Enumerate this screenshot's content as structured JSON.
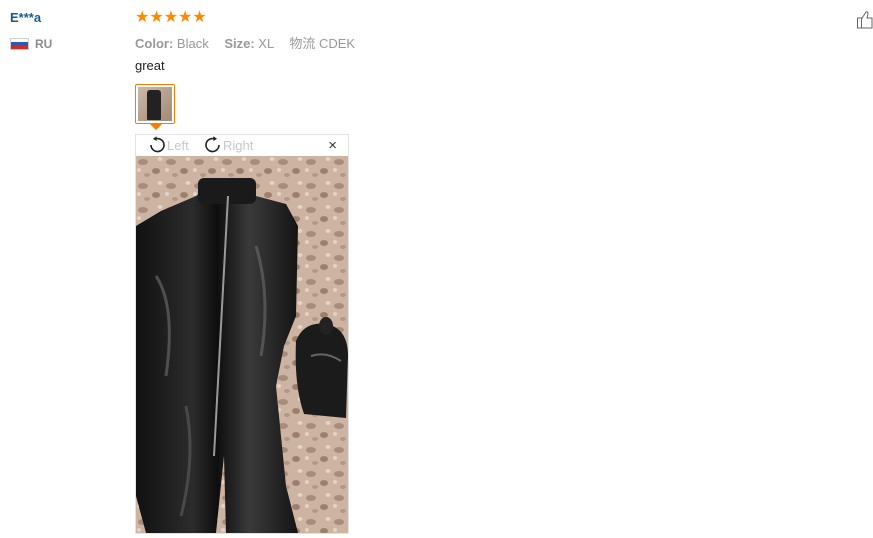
{
  "reviewer": {
    "name": "E***a",
    "country_code": "RU"
  },
  "rating": {
    "stars": 5,
    "max": 5
  },
  "attributes": {
    "color_label": "Color:",
    "color_value": "Black",
    "size_label": "Size:",
    "size_value": "XL",
    "shipping_label": "物流",
    "shipping_value": "CDEK"
  },
  "feedback": {
    "text": "great"
  },
  "viewer": {
    "rotate_left_label": "Left",
    "rotate_right_label": "Right",
    "close_symbol": "×"
  },
  "colors": {
    "star": "#ff8a00",
    "accent": "#ff7a00",
    "name": "#1a5b8e"
  },
  "icons": [
    "like-icon",
    "rotate-left-icon",
    "rotate-right-icon",
    "close-icon",
    "russia-flag-icon",
    "star-icon"
  ]
}
